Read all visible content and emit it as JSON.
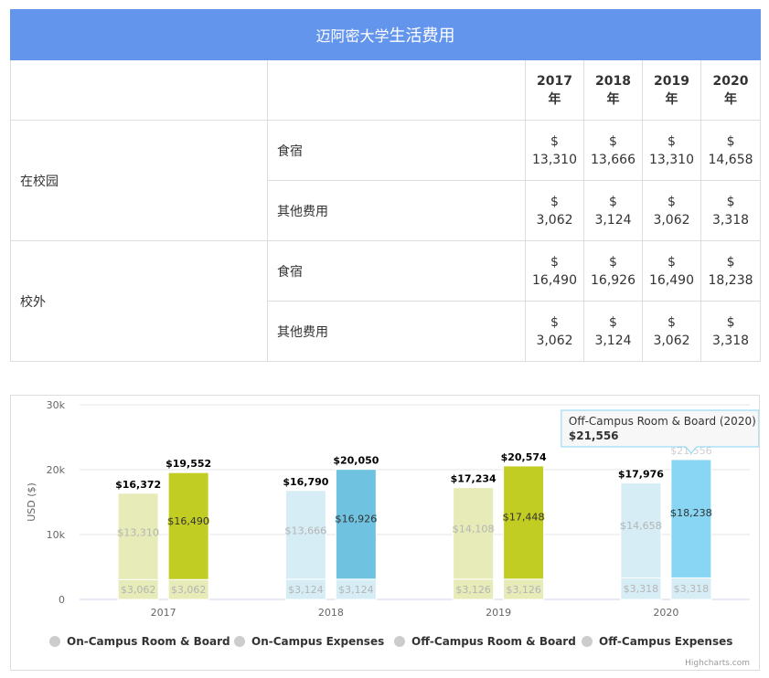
{
  "table": {
    "title_prefix": "迈阿密大学",
    "title_main": "生活费用",
    "year_headers": [
      "2017 年",
      "2018 年",
      "2019 年",
      "2020 年"
    ],
    "groups": [
      {
        "label": "在校园",
        "rows": [
          {
            "label": "食宿",
            "values": [
              "$ 13,310",
              "$ 13,666",
              "$ 13,310",
              "$ 14,658"
            ]
          },
          {
            "label": "其他费用",
            "values": [
              "$ 3,062",
              "$ 3,124",
              "$ 3,062",
              "$ 3,318"
            ]
          }
        ]
      },
      {
        "label": "校外",
        "rows": [
          {
            "label": "食宿",
            "values": [
              "$ 16,490",
              "$ 16,926",
              "$ 16,490",
              "$ 18,238"
            ]
          },
          {
            "label": "其他费用",
            "values": [
              "$ 3,062",
              "$ 3,124",
              "$ 3,062",
              "$ 3,318"
            ]
          }
        ]
      }
    ]
  },
  "chart_data": {
    "type": "bar",
    "stacked": true,
    "categories": [
      "2017",
      "2018",
      "2019",
      "2020"
    ],
    "ylabel": "USD ($)",
    "ylim": [
      0,
      30000
    ],
    "yticks": [
      0,
      10000,
      20000,
      30000
    ],
    "ytick_labels": [
      "0",
      "10k",
      "20k",
      "30k"
    ],
    "grid": true,
    "legend_position": "bottom",
    "stacks": [
      {
        "name": "On-Campus",
        "totals_labels": [
          "$16,372",
          "$16,790",
          "$17,234",
          "$17,976"
        ],
        "segments": [
          {
            "series": "On-Campus Expenses",
            "values": [
              3062,
              3124,
              3126,
              3318
            ],
            "labels": [
              "$3,062",
              "$3,124",
              "$3,126",
              "$3,318"
            ]
          },
          {
            "series": "On-Campus Room & Board",
            "values": [
              13310,
              13666,
              14108,
              14658
            ],
            "labels": [
              "$13,310",
              "$13,666",
              "$14,108",
              "$14,658"
            ]
          }
        ]
      },
      {
        "name": "Off-Campus",
        "totals_labels": [
          "$19,552",
          "$20,050",
          "$20,574",
          ""
        ],
        "segments": [
          {
            "series": "Off-Campus Expenses",
            "values": [
              3062,
              3124,
              3126,
              3318
            ],
            "labels": [
              "$3,062",
              "$3,124",
              "$3,126",
              "$3,318"
            ]
          },
          {
            "series": "Off-Campus Room & Board",
            "values": [
              16490,
              16926,
              17448,
              18238
            ],
            "labels": [
              "$16,490",
              "$16,926",
              "$17,448",
              "$18,238"
            ]
          }
        ]
      }
    ],
    "colors": {
      "2017": {
        "base": "#e6ebb8",
        "on_top": "#e6ebb8",
        "off_top": "#c2cd23"
      },
      "2018": {
        "base": "#d6edf5",
        "on_top": "#d6edf5",
        "off_top": "#6fc3e0"
      },
      "2019": {
        "base": "#e6ebb8",
        "on_top": "#e6ebb8",
        "off_top": "#c2cd23"
      },
      "2020": {
        "base": "#d6edf5",
        "on_top": "#d6edf5",
        "off_top": "#88d6f3"
      }
    },
    "tooltip": {
      "title": "Off-Campus Room & Board (2020)",
      "value": "$21,556",
      "year": "2020",
      "stack_total_label": "$21,556"
    },
    "legend": [
      "On-Campus Room & Board",
      "On-Campus Expenses",
      "Off-Campus Room & Board",
      "Off-Campus Expenses"
    ],
    "legend_color": "#cccccc",
    "credits": "Highcharts.com"
  }
}
